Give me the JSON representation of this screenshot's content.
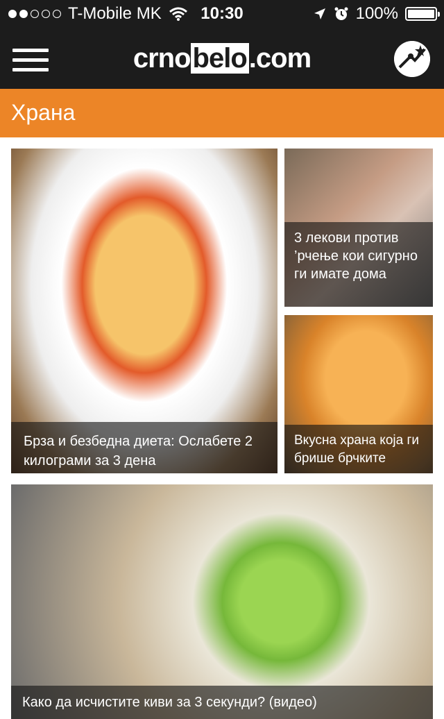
{
  "status_bar": {
    "carrier": "T-Mobile MK",
    "time": "10:30",
    "battery": "100%",
    "signal_dots_filled": 2,
    "signal_dots_total": 5
  },
  "nav": {
    "logo_left": "crno",
    "logo_mid": "belo",
    "logo_right": ".com",
    "menu_icon": "hamburger-menu-icon",
    "profile_icon": "profile-star-icon"
  },
  "category": {
    "title": "Храна"
  },
  "articles": [
    {
      "title": "Брза и безбедна диета: Ослабете 2 килограми за 3 дена",
      "image": "vegetable-soup-bowl"
    },
    {
      "title": "3 лекови против ’рчење кои сигурно ги имате дома",
      "image": "sleeping-man-snoring"
    },
    {
      "title": "Вкусна храна која ги брише брчките",
      "image": "baked-casserole-dish"
    },
    {
      "title": "Како да исчистите киви за 3 секунди? (видео)",
      "image": "peeling-kiwi-with-spoon"
    }
  ],
  "colors": {
    "header_bg": "#1c1c1c",
    "category_bar": "#ec8527",
    "caption_overlay": "rgba(20,20,20,0.62)"
  }
}
